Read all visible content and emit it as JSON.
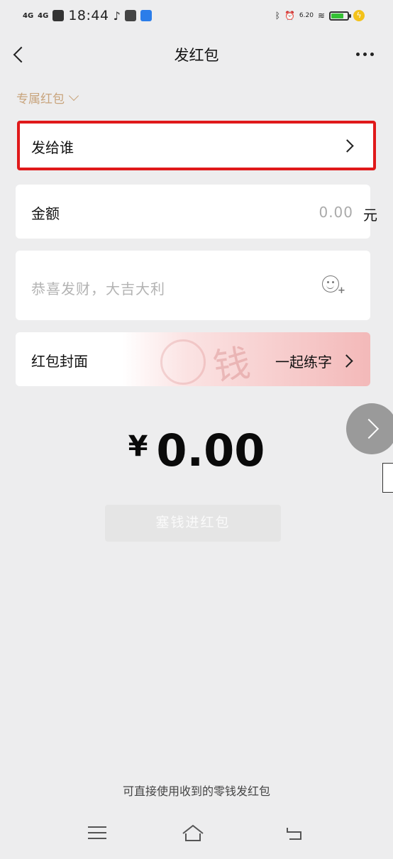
{
  "status_bar": {
    "signal1": "4G",
    "signal2": "4G",
    "time": "18:44",
    "speed": "6.20"
  },
  "nav": {
    "title": "发红包"
  },
  "exclusive_label": "专属红包",
  "recipient": {
    "label": "发给谁"
  },
  "amount": {
    "label": "金额",
    "value": "0.00",
    "unit": "元"
  },
  "blessing": {
    "placeholder": "恭喜发财，大吉大利"
  },
  "cover": {
    "label": "红包封面",
    "option": "一起练字",
    "art_char": "钱"
  },
  "total": {
    "currency": "¥",
    "value": "0.00"
  },
  "send_button": {
    "label": "塞钱进红包"
  },
  "footer_note": "可直接使用收到的零钱发红包",
  "colors": {
    "background": "#ededee",
    "highlight_border": "#e0191a",
    "exclusive_text": "#c8a47c"
  }
}
